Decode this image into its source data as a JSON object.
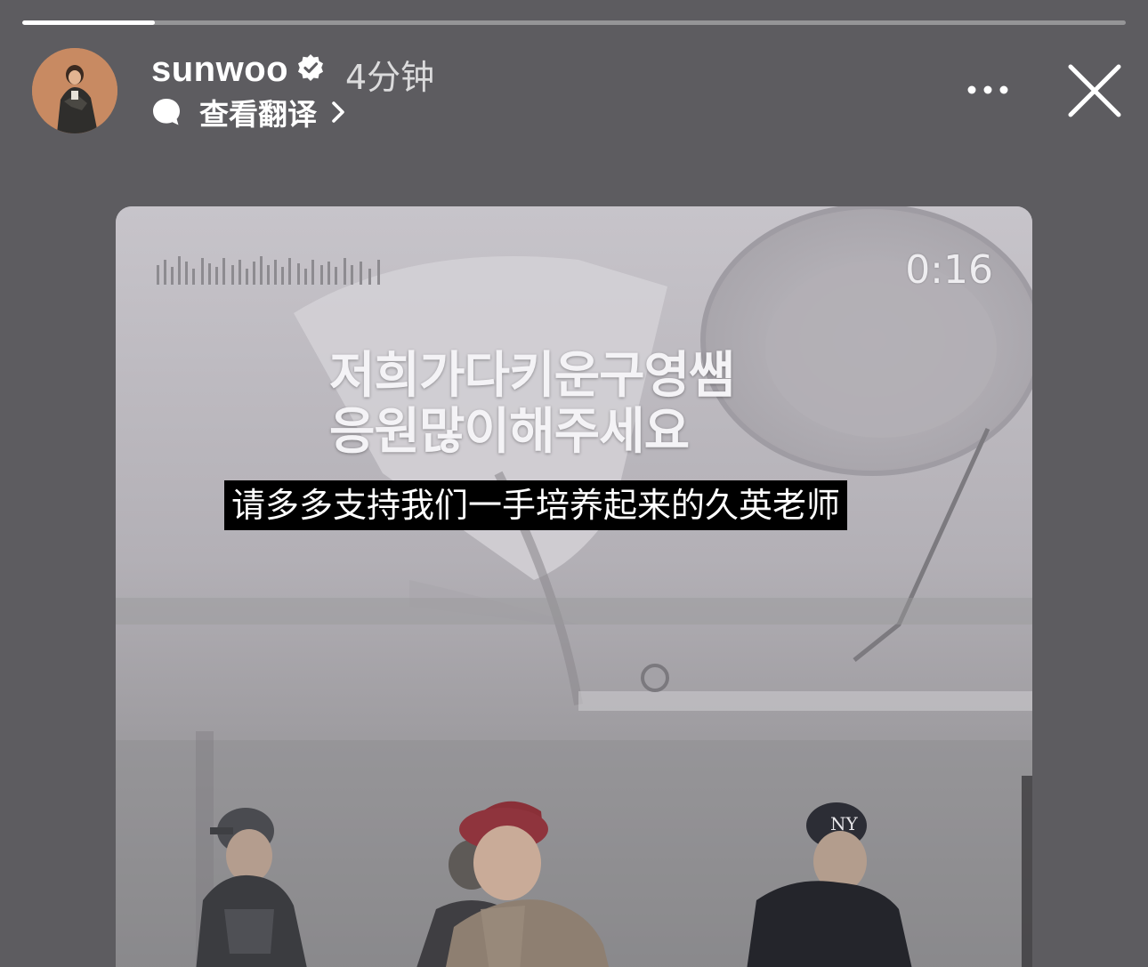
{
  "story": {
    "progress_fraction": 0.12,
    "user": {
      "username": "sunwoo",
      "verified": true,
      "timestamp": "4分钟"
    },
    "translate_label": "查看翻译",
    "icons": {
      "avatar": "profile-photo",
      "verified": "verified-badge-icon",
      "translate": "speech-bubble-icon",
      "chevron": "chevron-right-icon",
      "more": "more-horizontal-icon",
      "close": "close-icon"
    }
  },
  "video": {
    "time": "0:16",
    "korean_caption": {
      "line1": "저희가다키운구영쌤",
      "line2": "응원많이해주세요"
    },
    "subtitle": "请多多支持我们一手培养起来的久英老师"
  },
  "colors": {
    "background": "#5d5c60",
    "text": "#ffffff",
    "subtitle_bg": "#000000"
  }
}
